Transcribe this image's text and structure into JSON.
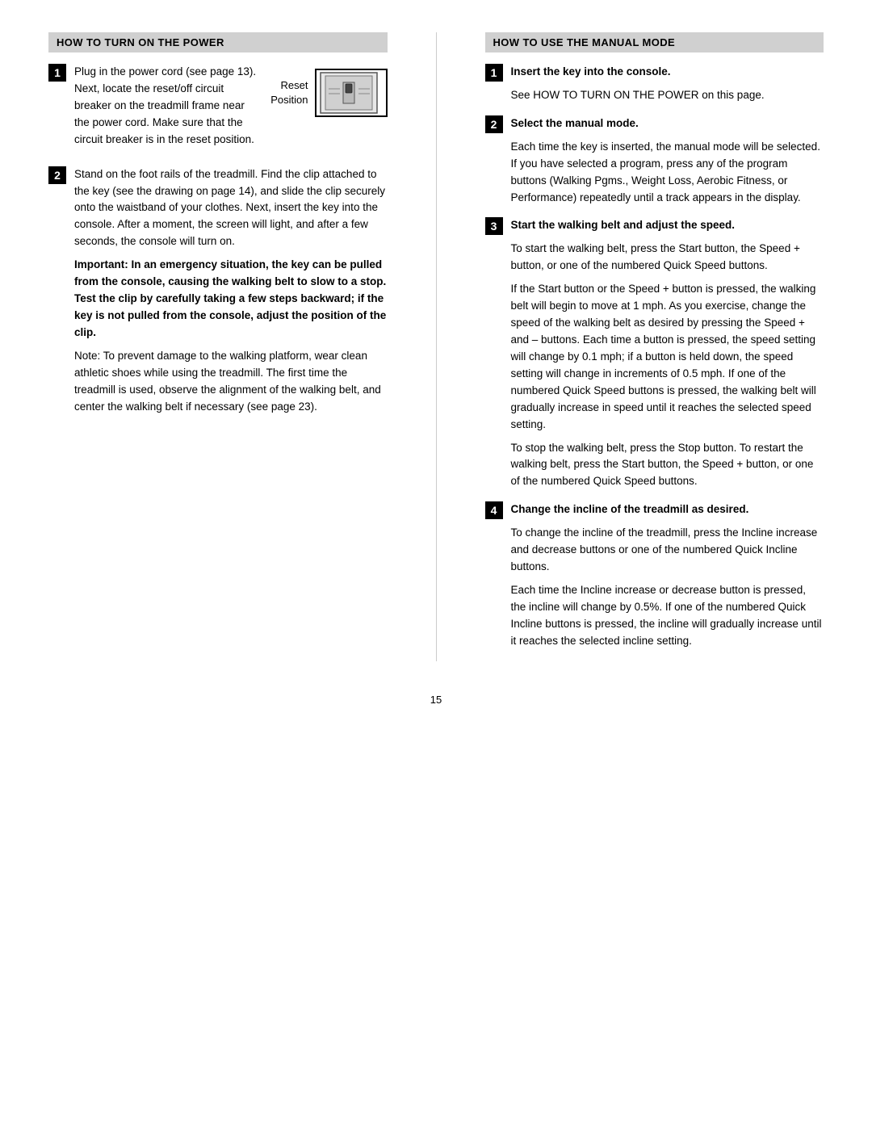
{
  "left_section": {
    "header": "HOW TO TURN ON THE POWER",
    "step1": {
      "number": "1",
      "text_before": "Plug in the power cord (see page 13). Next, locate the reset/off circuit breaker on the treadmill frame near the power cord. Make sure that the circuit breaker is in the reset position.",
      "reset_label": "Reset\nPosition"
    },
    "step2": {
      "number": "2",
      "text": "Stand on the foot rails of the treadmill. Find the clip attached to the key (see the drawing on page 14), and slide the clip securely onto the waistband of your clothes. Next, insert the key into the console. After a moment, the screen will light, and after a few seconds, the console will turn on.",
      "bold_text": "Important: In an emergency situation, the key can be pulled from the console, causing the walking belt to slow to a stop. Test the clip by carefully taking a few steps backward; if the key is not pulled from the console, adjust the position of the clip.",
      "note": "Note: To prevent damage to the walking platform, wear clean athletic shoes while using the treadmill. The first time the treadmill is used, observe the alignment of the walking belt, and center the walking belt if necessary (see page 23)."
    }
  },
  "right_section": {
    "header": "HOW TO USE THE MANUAL MODE",
    "step1": {
      "number": "1",
      "header": "Insert the key into the console.",
      "body": "See HOW TO TURN ON THE POWER on this page."
    },
    "step2": {
      "number": "2",
      "header": "Select the manual mode.",
      "body": "Each time the key is inserted, the manual mode will be selected. If you have selected a program, press any of the program buttons (Walking Pgms., Weight Loss, Aerobic Fitness, or Performance) repeatedly until a track appears in the display."
    },
    "step3": {
      "number": "3",
      "header": "Start the walking belt and adjust the speed.",
      "body1": "To start the walking belt, press the Start button, the Speed + button, or one of the numbered Quick Speed buttons.",
      "body2": "If the Start button or the Speed + button is pressed, the walking belt will begin to move at 1 mph. As you exercise, change the speed of the walking belt as desired by pressing the Speed + and – buttons. Each time a button is pressed, the speed setting will change by 0.1 mph; if a button is held down, the speed setting will change in increments of 0.5 mph. If one of the numbered Quick Speed buttons is pressed, the walking belt will gradually increase in speed until it reaches the selected speed setting.",
      "body3": "To stop the walking belt, press the Stop button. To restart the walking belt, press the Start button, the Speed + button, or one of the numbered Quick Speed buttons."
    },
    "step4": {
      "number": "4",
      "header": "Change the incline of the treadmill as desired.",
      "body1": "To change the incline of the treadmill, press the Incline increase and decrease buttons or one of the numbered Quick Incline buttons.",
      "body2": "Each time the Incline increase or decrease button is pressed, the incline will change by 0.5%. If one of the numbered Quick Incline buttons is pressed, the incline will gradually increase until it reaches the selected incline setting."
    }
  },
  "page_number": "15"
}
